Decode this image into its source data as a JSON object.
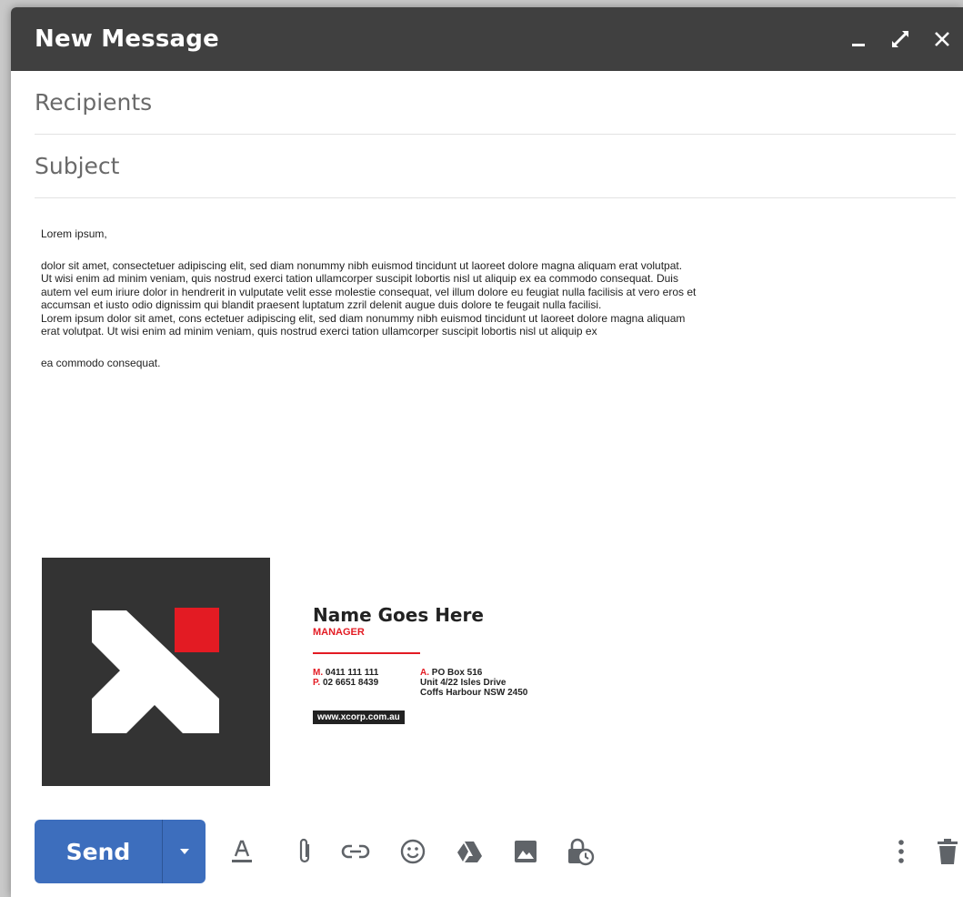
{
  "window": {
    "title": "New Message"
  },
  "recipients": {
    "placeholder": "Recipients"
  },
  "subject": {
    "placeholder": "Subject"
  },
  "body": {
    "greeting": "Lorem ipsum,",
    "lines": [
      "dolor sit amet, consectetuer adipiscing elit, sed diam nonummy nibh euismod tincidunt ut laoreet dolore magna aliquam erat volutpat.",
      "Ut wisi enim ad minim veniam, quis nostrud exerci tation ullamcorper suscipit lobortis nisl ut aliquip ex ea commodo consequat. Duis",
      "autem vel eum iriure dolor in hendrerit in vulputate velit esse molestie consequat, vel illum dolore eu feugiat nulla facilisis at vero eros et",
      "accumsan et iusto odio dignissim qui blandit praesent luptatum zzril delenit augue duis dolore te feugait nulla facilisi.",
      "Lorem ipsum dolor sit amet, cons ectetuer adipiscing elit, sed diam nonummy nibh euismod tincidunt ut laoreet dolore magna aliquam",
      "erat volutpat. Ut wisi enim ad minim veniam, quis nostrud exerci tation ullamcorper suscipit lobortis nisl ut aliquip ex"
    ],
    "closing": "ea commodo consequat."
  },
  "signature": {
    "name": "Name Goes Here",
    "role": "MANAGER",
    "mobile_label": "M.",
    "mobile": "0411 111 111",
    "phone_label": "P.",
    "phone": "02 6651 8439",
    "address_label": "A.",
    "address_line1": "PO Box 516",
    "address_line2": "Unit 4/22 Isles Drive",
    "address_line3": "Coffs Harbour NSW 2450",
    "website": "www.xcorp.com.au",
    "accent_color": "#e31b23",
    "logo_bg_color": "#333333"
  },
  "toolbar": {
    "send_label": "Send",
    "send_color": "#3d6ebd",
    "icons": [
      "format-text-icon",
      "attach-icon",
      "link-icon",
      "emoji-icon",
      "drive-icon",
      "photo-icon",
      "confidential-icon",
      "more-options-icon",
      "delete-icon"
    ]
  },
  "colors": {
    "titlebar": "#404040",
    "icon_gray": "#5f6368"
  }
}
